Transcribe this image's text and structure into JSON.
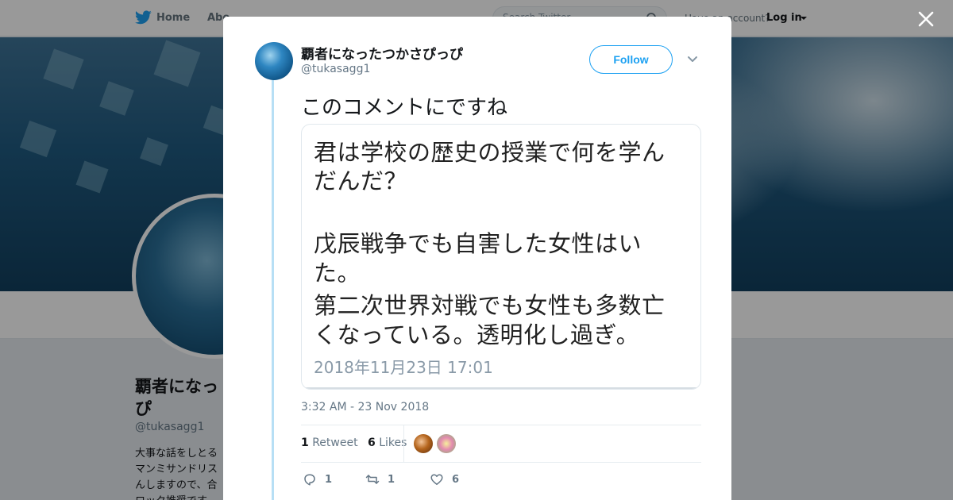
{
  "background_page": {
    "nav": {
      "home_label": "Home",
      "about_label": "Abo",
      "search_placeholder": "Search Twitter",
      "have_account_text": "Have an account?",
      "login_label": "Log in"
    },
    "profile": {
      "name": "覇者になったつかさぴっぴ",
      "name_line1": "覇者になっ",
      "name_line2": "ぴ",
      "handle": "@tukasagg1",
      "bio_lines": [
        "大事な話をしとる",
        "マンミサンドリス",
        "んしますので、合",
        "ロック推奨です。"
      ]
    }
  },
  "modal": {
    "author": {
      "name": "覇者になったつかさぴっぴ",
      "handle": "@tukasagg1",
      "avatar_icon": "user-avatar-icon"
    },
    "follow_label": "Follow",
    "tweet_text": "このコメントにですね",
    "media": {
      "lines": [
        "君は学校の歴史の授業で何を学ん",
        "だんだ？",
        "",
        "戊辰戦争でも自害した女性はい",
        "た。",
        "第二次世界対戦でも女性も多数亡",
        "くなっている。透明化し過ぎ。"
      ],
      "date": "2018年11月23日 17:01"
    },
    "timestamp": "3:32 AM - 23 Nov 2018",
    "stats": {
      "retweet_count": "1",
      "retweet_label": "Retweet",
      "like_count": "6",
      "like_label": "Likes"
    },
    "actions": {
      "reply_count": "1",
      "retweet_count": "1",
      "like_count": "6"
    }
  },
  "colors": {
    "accent": "#1da1f2",
    "text_primary": "#14171a",
    "text_secondary": "#657786",
    "thread_line": "#b7dff5"
  }
}
